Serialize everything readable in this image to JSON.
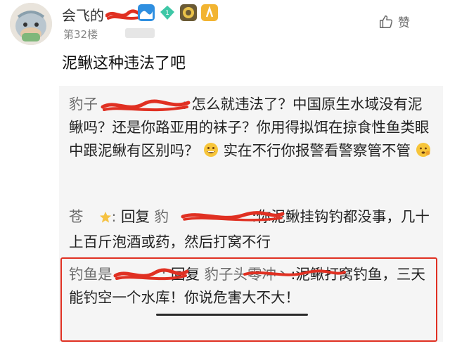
{
  "post": {
    "username_visible": "会飞的",
    "floor": "第32楼",
    "like_label": "赞",
    "content": "泥鳅这种违法了吧"
  },
  "replies": [
    {
      "nick": "豹子",
      "sep": ":",
      "text": "怎么就违法了？中国原生水域没有泥鳅吗？还是你路亚用的袜子？你用得拟饵在掠食性鱼类眼中跟泥鳅有区别吗？",
      "text2": "实在不行你报警看警察管不管"
    },
    {
      "nick": "苍",
      "sep": ":",
      "reply_label": "回复",
      "reply_to": "豹",
      "text": ":你泥鳅挂钩钓都没事，几十上百斤泡酒或药，然后打窝不行"
    },
    {
      "nick": "钓鱼是",
      "sep": ":",
      "reply_label": "回复",
      "reply_to": "豹子头零冲丶",
      "text_before": ":泥鳅打窝钓鱼，",
      "text_highlight": "三天能钓空一个水库",
      "text_after": "！你说危害大不大！"
    }
  ],
  "colors": {
    "accent_red": "#e03022",
    "nick_gray": "#6b6b6b",
    "reply_bg": "#f5f5f5"
  },
  "icons": [
    "avatar",
    "wave-badge",
    "diamond-badge",
    "level-badge",
    "yellow-badge",
    "thumb-up-icon",
    "grin-emoji",
    "shrug-emoji",
    "star-emoji"
  ]
}
